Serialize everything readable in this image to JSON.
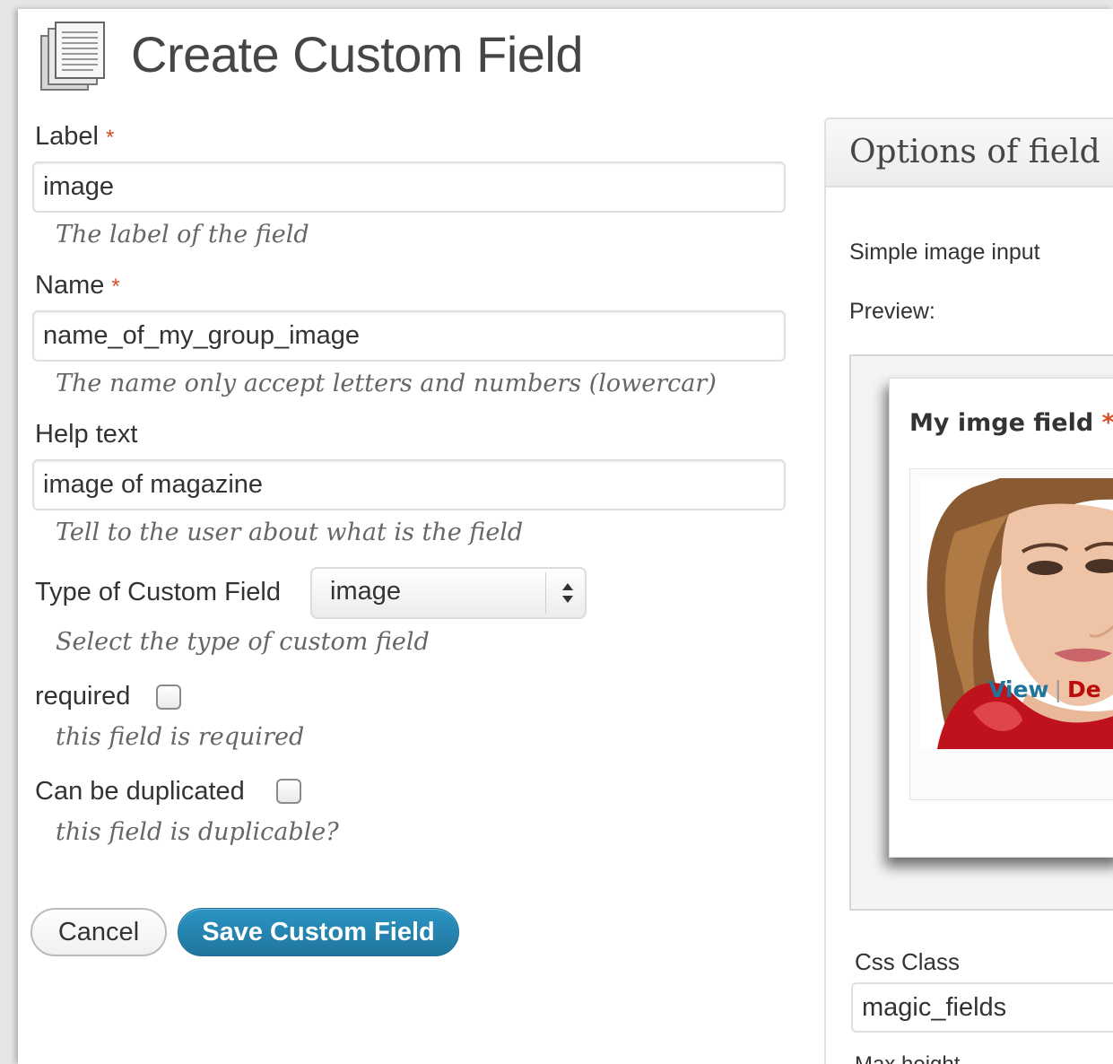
{
  "header": {
    "title": "Create Custom Field",
    "icon": "page-stack-icon"
  },
  "form": {
    "label": {
      "label": "Label",
      "required_mark": "*",
      "value": "image",
      "hint": "The label of the field"
    },
    "name": {
      "label": "Name",
      "required_mark": "*",
      "value": "name_of_my_group_image",
      "hint": "The name only accept letters and numbers (lowercar)"
    },
    "help_text": {
      "label": "Help text",
      "value": "image of magazine",
      "hint": "Tell to the user about what is the field"
    },
    "type": {
      "label": "Type of Custom Field",
      "value": "image",
      "hint": "Select the type of custom field"
    },
    "required": {
      "label": "required",
      "checked": false,
      "hint": "this field is required"
    },
    "duplicated": {
      "label": "Can be duplicated",
      "checked": false,
      "hint": "this field is duplicable?"
    },
    "buttons": {
      "cancel": "Cancel",
      "save": "Save Custom Field"
    }
  },
  "options_panel": {
    "title": "Options of field",
    "description": "Simple image input",
    "preview_label": "Preview:",
    "preview": {
      "field_label": "My imge field",
      "required_mark": "*",
      "view_link": "View",
      "separator": "|",
      "delete_link": "De"
    },
    "css_class": {
      "label": "Css Class",
      "value": "magic_fields"
    },
    "max_height_label": "Max height"
  },
  "colors": {
    "accent": "#21759b",
    "required": "#d54e21",
    "delete": "#bc0b0b"
  }
}
